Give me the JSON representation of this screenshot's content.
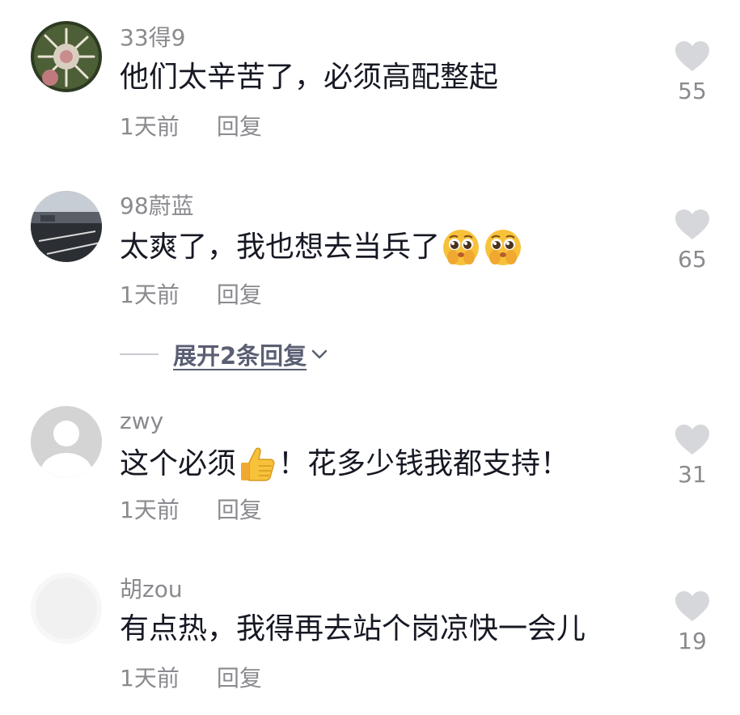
{
  "comments": [
    {
      "username": "33得9",
      "text_before": "他们太辛苦了，必须高配整起",
      "text_after": "",
      "emoji_names": [],
      "time": "1天前",
      "reply_label": "回复",
      "likes": "55",
      "avatar": "succulent-plant-photo"
    },
    {
      "username": "98蔚蓝",
      "text_before": "太爽了，我也想去当兵了",
      "text_after": "",
      "emoji_names": [
        "pleading-face-emoji",
        "pleading-face-emoji"
      ],
      "time": "1天前",
      "reply_label": "回复",
      "likes": "65",
      "avatar": "road-photo"
    },
    {
      "username": "zwy",
      "text_before": "这个必须",
      "text_after": "！花多少钱我都支持！",
      "emoji_names": [
        "thumbs-up-emoji"
      ],
      "time": "1天前",
      "reply_label": "回复",
      "likes": "31",
      "avatar": "default-avatar"
    },
    {
      "username": "胡zou",
      "text_before": "有点热，我得再去站个岗凉快一会儿",
      "text_after": "",
      "emoji_names": [],
      "time": "1天前",
      "reply_label": "回复",
      "likes": "19",
      "avatar": "faded-avatar"
    }
  ],
  "expand_replies": {
    "label": "展开2条回复",
    "icon": "chevron-down-icon"
  },
  "colors": {
    "username": "#8a8a8f",
    "text": "#161823",
    "heart": "#d6d7db",
    "expand": "#5a5f73"
  }
}
